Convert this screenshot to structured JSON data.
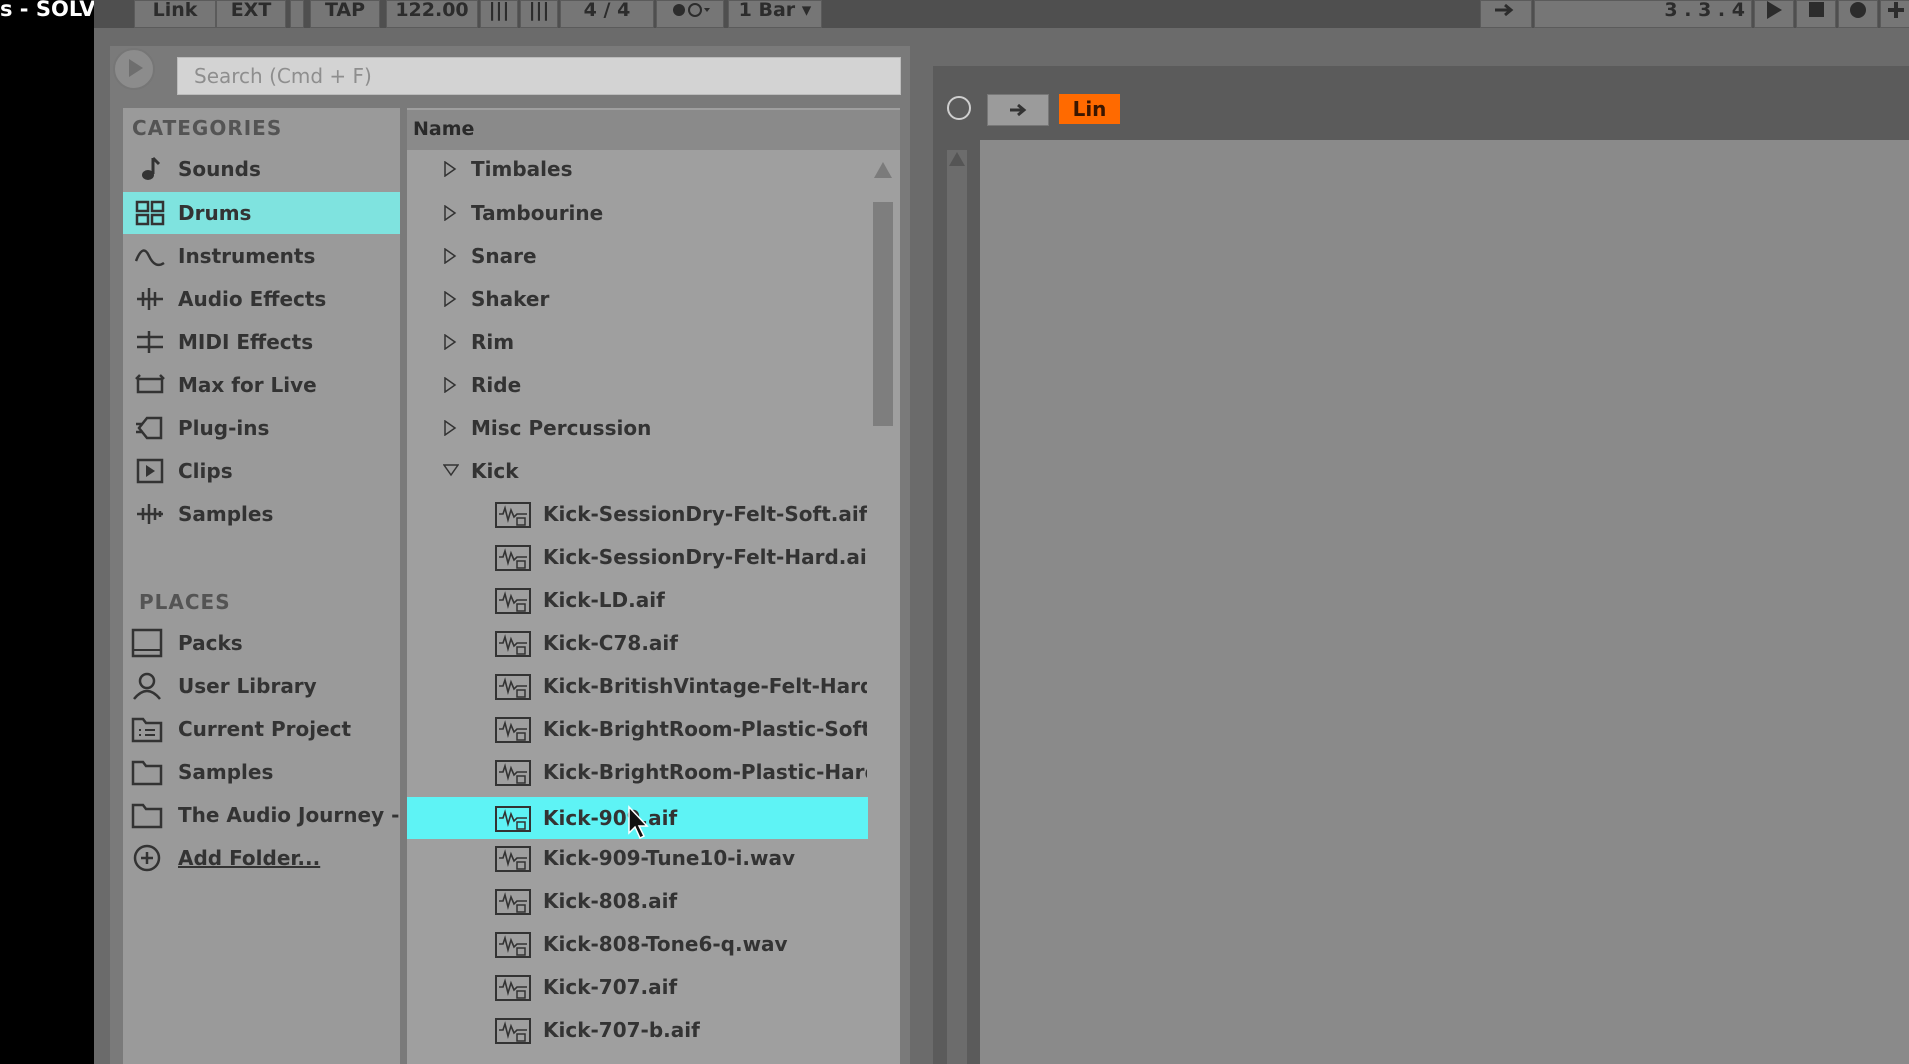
{
  "window_title": "s - SOLVED!",
  "transport": {
    "link": "Link",
    "ext": "EXT",
    "tap": "TAP",
    "tempo": "122.00",
    "time_sig_num": "4",
    "time_sig_sep": "/",
    "time_sig_den": "4",
    "quantize": "1 Bar",
    "position": [
      "3",
      "3",
      "4"
    ]
  },
  "search": {
    "placeholder": "Search (Cmd + F)"
  },
  "categories": {
    "title": "CATEGORIES",
    "items": [
      {
        "label": "Sounds",
        "icon": "note-icon"
      },
      {
        "label": "Drums",
        "icon": "grid-icon",
        "selected": true
      },
      {
        "label": "Instruments",
        "icon": "waveform-icon"
      },
      {
        "label": "Audio Effects",
        "icon": "audio-effects-icon"
      },
      {
        "label": "MIDI Effects",
        "icon": "midi-effects-icon"
      },
      {
        "label": "Max for Live",
        "icon": "max-icon"
      },
      {
        "label": "Plug-ins",
        "icon": "plugin-icon"
      },
      {
        "label": "Clips",
        "icon": "clip-icon"
      },
      {
        "label": "Samples",
        "icon": "sample-icon"
      }
    ]
  },
  "places": {
    "title": "PLACES",
    "items": [
      {
        "label": "Packs",
        "icon": "packs-icon"
      },
      {
        "label": "User Library",
        "icon": "user-icon"
      },
      {
        "label": "Current Project",
        "icon": "project-folder-icon"
      },
      {
        "label": "Samples",
        "icon": "folder-icon"
      },
      {
        "label": "The Audio Journey -",
        "icon": "folder-icon"
      },
      {
        "label": "Add Folder...",
        "icon": "add-icon"
      }
    ]
  },
  "list": {
    "column_header": "Name",
    "folders": [
      "Timbales",
      "Tambourine",
      "Snare",
      "Shaker",
      "Rim",
      "Ride",
      "Misc Percussion"
    ],
    "open_folder": "Kick",
    "files": [
      "Kick-SessionDry-Felt-Soft.aif",
      "Kick-SessionDry-Felt-Hard.aif",
      "Kick-LD.aif",
      "Kick-C78.aif",
      "Kick-BritishVintage-Felt-Hard.aif",
      "Kick-BrightRoom-Plastic-Soft.aif",
      "Kick-BrightRoom-Plastic-Hard.aif",
      "Kick-909.aif",
      "Kick-909-Tune10-i.wav",
      "Kick-808.aif",
      "Kick-808-Tone6-q.wav",
      "Kick-707.aif",
      "Kick-707-b.aif"
    ],
    "selected_file": "Kick-909.aif"
  },
  "right_panel": {
    "lin_label": "Lin"
  },
  "colors": {
    "selected": "#7fe3df",
    "highlight": "#5ef3f5",
    "accent": "#ff6a00"
  }
}
